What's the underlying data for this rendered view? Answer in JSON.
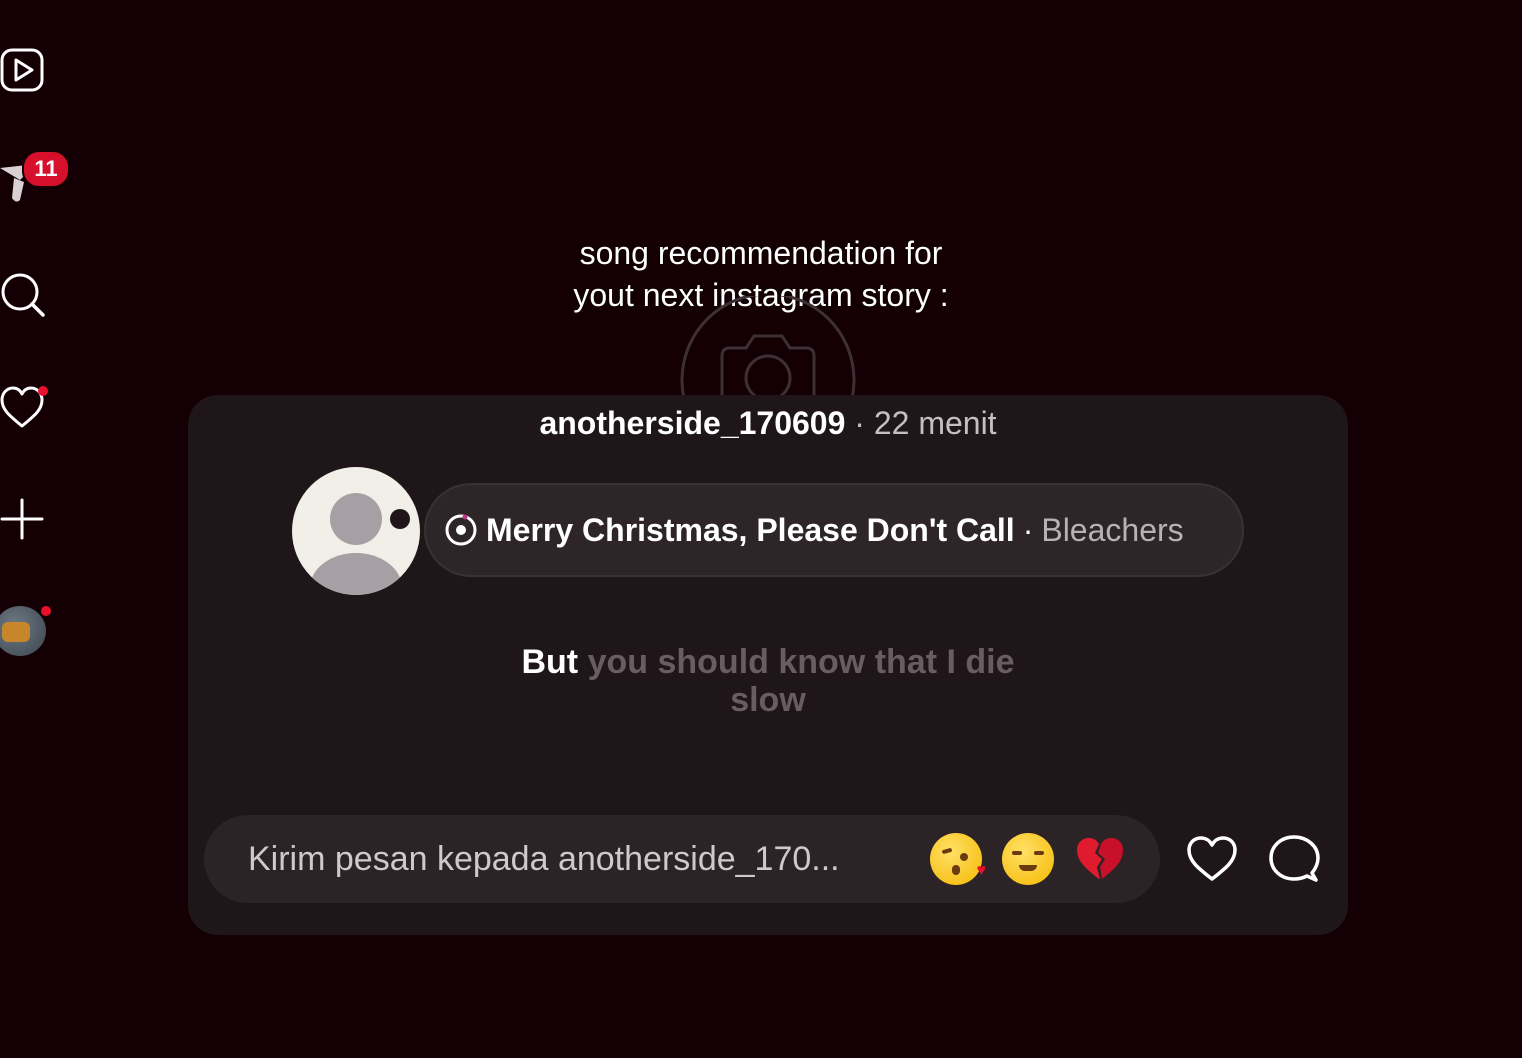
{
  "sidebar": {
    "items": [
      {
        "name": "reels-icon"
      },
      {
        "name": "messages-icon",
        "badge": "11"
      },
      {
        "name": "search-icon"
      },
      {
        "name": "notifications-icon"
      },
      {
        "name": "create-icon"
      },
      {
        "name": "profile-avatar"
      }
    ]
  },
  "caption": {
    "line1": "song recommendation for",
    "line2": "yout next instagram story :"
  },
  "story": {
    "username": "anotherside_170609",
    "time": " · 22 menit",
    "music": {
      "song": "Merry Christmas, Please Don't Call",
      "separator": "·",
      "artist": "Bleachers"
    },
    "lyrics": {
      "active": "But",
      "inactive_line1": "you should know that I die",
      "inactive_line2": "slow"
    },
    "reply": {
      "placeholder": "Kirim pesan kepada anotherside_170..."
    },
    "quick_reactions": [
      "kissing-heart-emoji",
      "relieved-face-emoji",
      "broken-heart-emoji"
    ]
  },
  "colors": {
    "background": "#140004",
    "card": "#1e1618",
    "badge": "#d6102b",
    "lyric_inactive": "#6a5d61"
  }
}
